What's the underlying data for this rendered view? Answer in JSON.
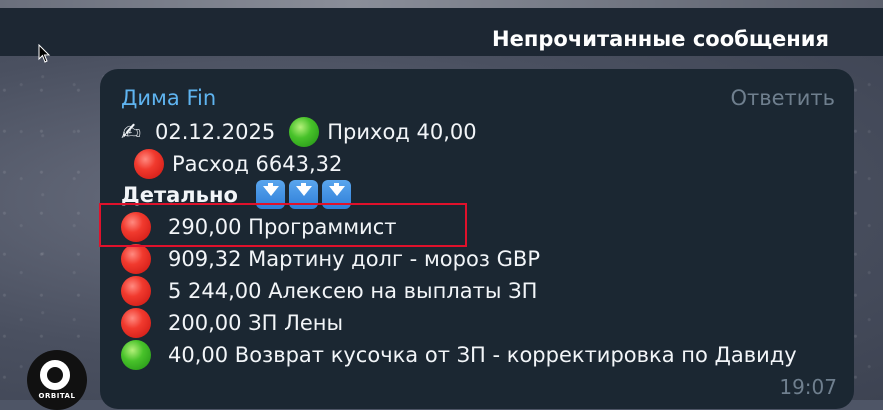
{
  "header": {
    "title": "Непрочитанные сообщения"
  },
  "message": {
    "sender": "Дима Fin",
    "reply_label": "Ответить",
    "line1": {
      "icon": "writing-hand-icon",
      "date": "02.12.2025",
      "status": "green",
      "label": "Приход  40,00"
    },
    "line2": {
      "status": "red",
      "label": "Расход  6643,32"
    },
    "detail_label": "Детально",
    "items": [
      {
        "status": "red",
        "text": "290,00  Программист"
      },
      {
        "status": "red",
        "text": "909,32  Мартину долг - мороз GBP"
      },
      {
        "status": "red",
        "text": "5 244,00  Алексею на выплаты ЗП"
      },
      {
        "status": "red",
        "text": "200,00  ЗП Лены"
      },
      {
        "status": "green",
        "text": "40,00  Возврат кусочка от ЗП - корректировка по Давиду"
      }
    ],
    "time": "19:07"
  },
  "avatar": {
    "text": "ORBITAL"
  },
  "colors": {
    "sender": "#5fb4f0",
    "bubble": "#1b2732",
    "highlight": "#e0112b"
  }
}
